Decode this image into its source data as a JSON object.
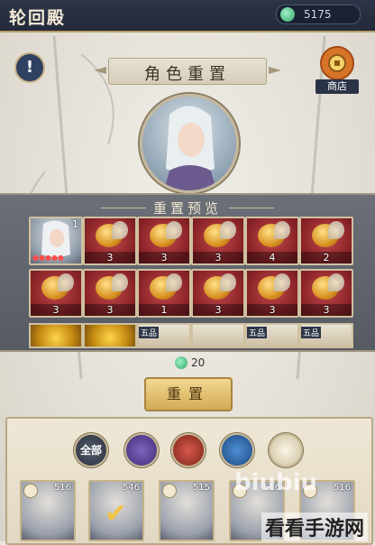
{
  "header": {
    "title": "轮回殿",
    "currency_value": "5175"
  },
  "section_title": "角色重置",
  "shop_label": "商店",
  "preview": {
    "title": "重置预览",
    "row1": [
      "",
      "3",
      "3",
      "3",
      "4",
      "2"
    ],
    "row1_char_count": "1",
    "row2": [
      "3",
      "3",
      "1",
      "3",
      "3",
      "3"
    ],
    "row3_tags": [
      "五品",
      "五品",
      "五品"
    ]
  },
  "cost": "20",
  "reset_label": "重置",
  "filters": [
    "全部",
    "",
    "",
    "",
    ""
  ],
  "characters": [
    {
      "level": "516"
    },
    {
      "level": "546"
    },
    {
      "level": "515"
    },
    {
      "level": "516"
    },
    {
      "level": "516"
    }
  ],
  "watermark": "biubiu",
  "watermark2": "看看手游网"
}
